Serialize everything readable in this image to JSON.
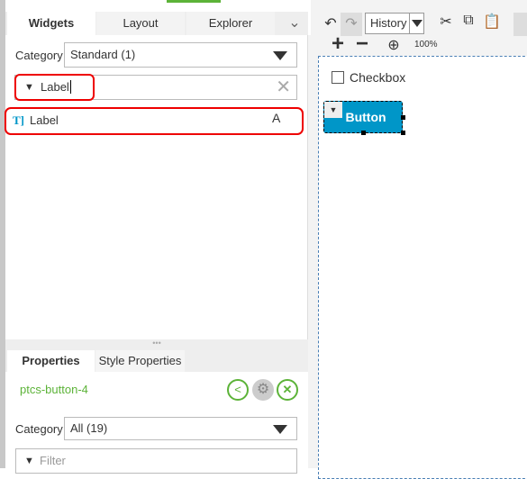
{
  "tabs": [
    {
      "label": "Widgets",
      "active": true
    },
    {
      "label": "Layout"
    },
    {
      "label": "Explorer"
    }
  ],
  "toolbar": {
    "history_label": "History",
    "zoom_level": "100%"
  },
  "widgets": {
    "category_label": "Category",
    "category_value": "Standard (1)",
    "filter_value": "Label",
    "items": [
      {
        "label": "Label"
      }
    ]
  },
  "canvas": {
    "checkbox_label": "Checkbox",
    "button_label": "Button",
    "accent": "#0096c8"
  },
  "properties": {
    "tabs": [
      {
        "label": "Properties",
        "active": true
      },
      {
        "label": "Style Properties"
      }
    ],
    "widget_id": "ptcs-button-4",
    "category_label": "Category",
    "category_value": "All (19)",
    "filter_placeholder": "Filter",
    "id_color": "#5cb338"
  }
}
